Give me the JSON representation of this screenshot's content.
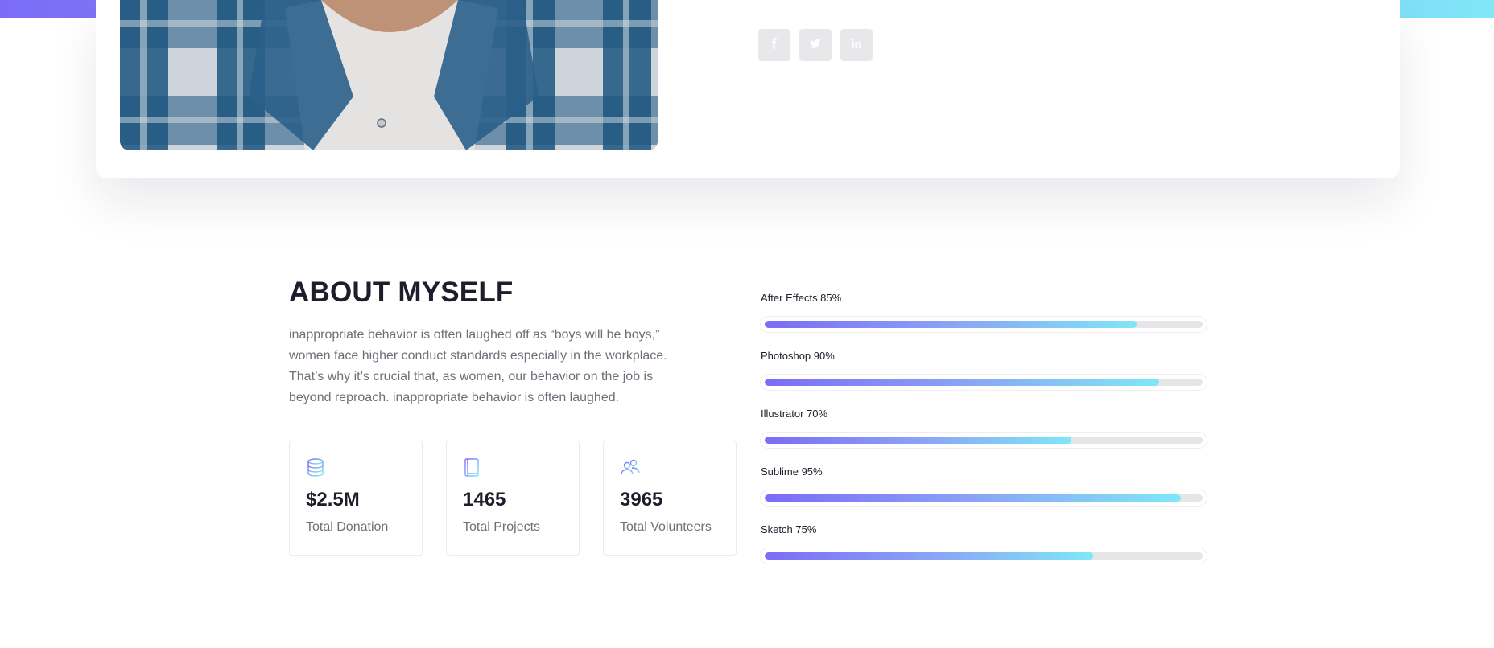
{
  "profile": {
    "social": [
      {
        "name": "facebook-icon",
        "glyph": "f"
      },
      {
        "name": "twitter-icon",
        "glyph": "t"
      },
      {
        "name": "linkedin-icon",
        "glyph": "in"
      }
    ]
  },
  "about": {
    "title": "ABOUT MYSELF",
    "text": "inappropriate behavior is often laughed off as “boys will be boys,” women face higher conduct standards especially in the workplace. That’s why it’s crucial that, as women, our behavior on the job is beyond reproach. inappropriate behavior is often laughed.",
    "stats": [
      {
        "icon": "database-icon",
        "value": "$2.5M",
        "label": "Total Donation"
      },
      {
        "icon": "book-icon",
        "value": "1465",
        "label": "Total Projects"
      },
      {
        "icon": "users-icon",
        "value": "3965",
        "label": "Total Volunteers"
      }
    ]
  },
  "skills": [
    {
      "label": "After Effects 85%",
      "percent": 85
    },
    {
      "label": "Photoshop 90%",
      "percent": 90
    },
    {
      "label": "Illustrator 70%",
      "percent": 70
    },
    {
      "label": "Sublime 95%",
      "percent": 95
    },
    {
      "label": "Sketch 75%",
      "percent": 75
    }
  ],
  "colors": {
    "accent_start": "#7b6cf6",
    "accent_mid": "#8aa3f5",
    "accent_end": "#7fe7f7",
    "heading": "#1d1d2b",
    "body_text": "#6f6f7a"
  }
}
